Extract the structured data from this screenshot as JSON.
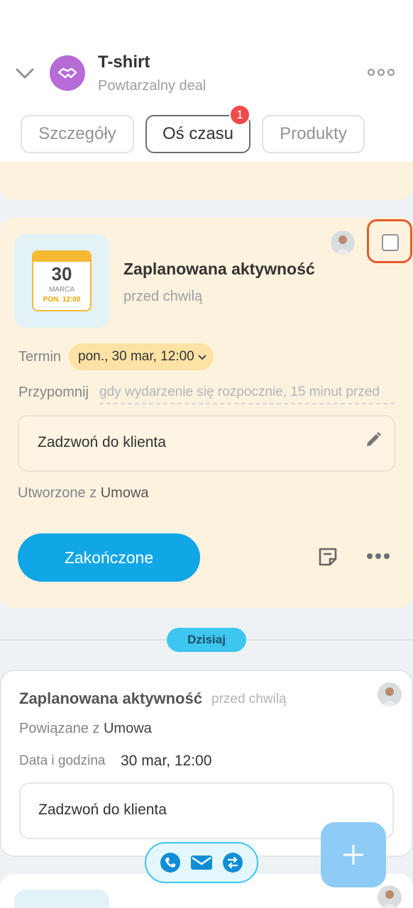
{
  "header": {
    "title": "T-shirt",
    "subtitle": "Powtarzalny deal",
    "icons": [
      "chevron-down-icon",
      "handshake-icon",
      "more-icon"
    ]
  },
  "tabs": [
    {
      "label": "Szczegóły",
      "active": false
    },
    {
      "label": "Oś czasu",
      "active": true,
      "badge": "1"
    },
    {
      "label": "Produkty",
      "active": false
    }
  ],
  "activity": {
    "calendar": {
      "day": "30",
      "month": "MARCA",
      "weekday_time": "PON. 12:00"
    },
    "title": "Zaplanowana aktywność",
    "time": "przed chwilą",
    "deadline_label": "Termin",
    "deadline_value": "pon., 30 mar, 12:00",
    "remind_label": "Przypomnij",
    "remind_value": "gdy wydarzenie się rozpocznie, 15 minut przed",
    "description": "Zadzwoń do klienta",
    "created_label": "Utworzone z",
    "created_source": "Umowa",
    "done_button": "Zakończone",
    "highlight_color": "#e65c2c"
  },
  "separator": {
    "label": "Dzisiaj"
  },
  "history": {
    "title": "Zaplanowana aktywność",
    "time": "przed chwilą",
    "related_label": "Powiązane z",
    "related_value": "Umowa",
    "date_label": "Data i godzina",
    "date_value": "30 mar, 12:00",
    "description": "Zadzwoń do klienta"
  },
  "contact_bar": {
    "icons": [
      "phone-icon",
      "mail-icon",
      "chat-icon"
    ]
  },
  "colors": {
    "accent": "#11a6e6",
    "card_bg": "#fdf2dd",
    "badge": "#ef4b4b"
  }
}
